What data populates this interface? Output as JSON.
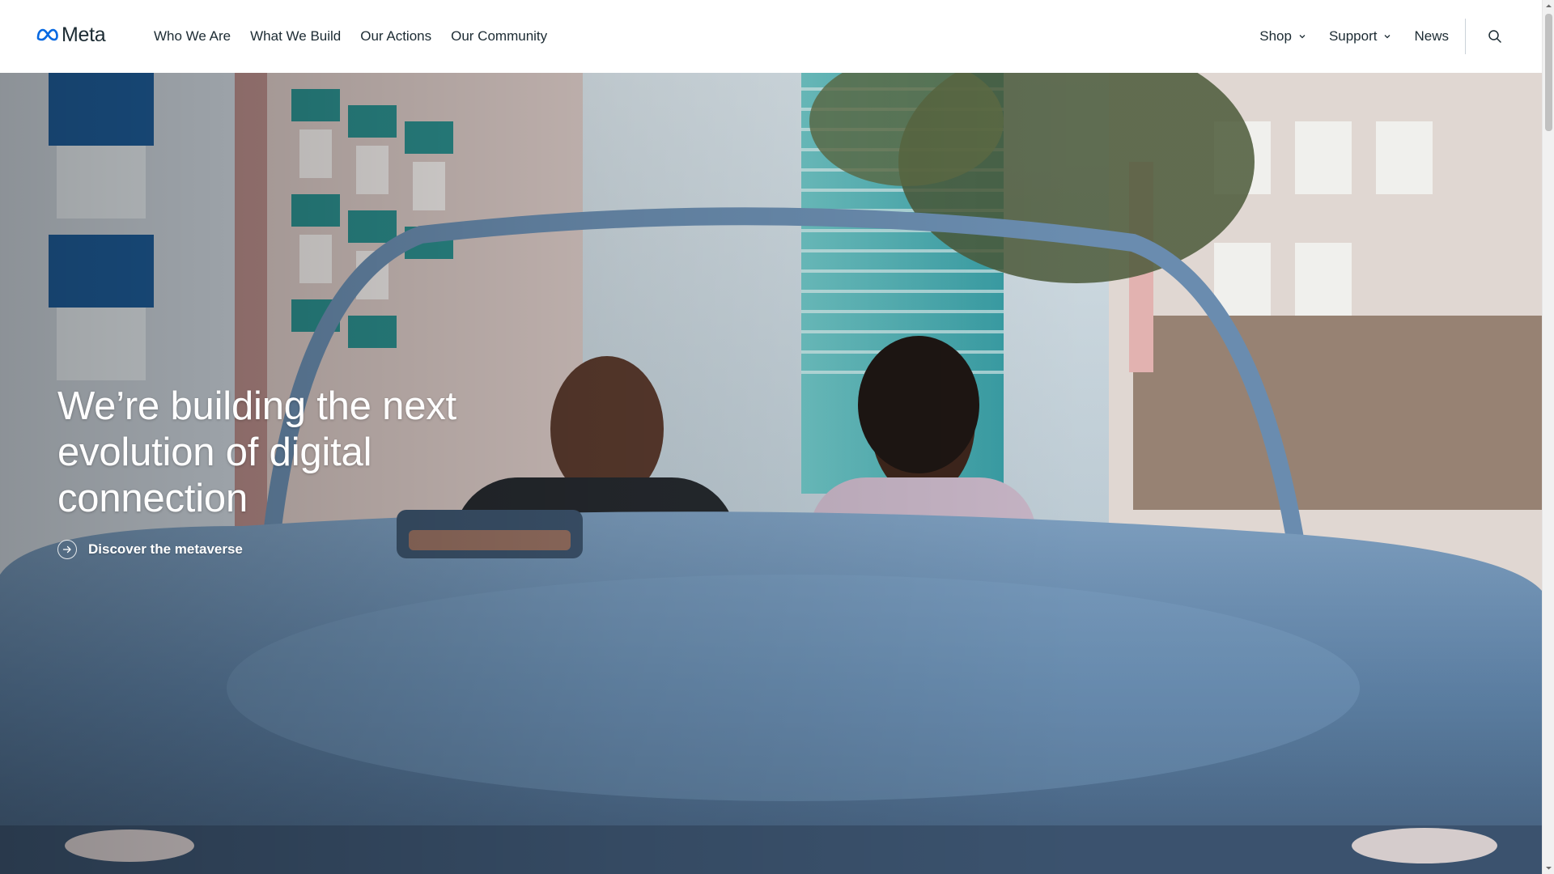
{
  "header": {
    "logo_text": "Meta",
    "nav_left": [
      {
        "label": "Who We Are"
      },
      {
        "label": "What We Build"
      },
      {
        "label": "Our Actions"
      },
      {
        "label": "Our Community"
      }
    ],
    "nav_right": [
      {
        "label": "Shop",
        "has_dropdown": true
      },
      {
        "label": "Support",
        "has_dropdown": true
      },
      {
        "label": "News",
        "has_dropdown": false
      }
    ],
    "search_icon": "search-icon"
  },
  "hero": {
    "title": "We’re building the next evolution of digital connection",
    "cta_label": "Discover the metaverse",
    "cta_icon": "arrow-right-icon"
  },
  "colors": {
    "brand_blue": "#0668e1",
    "text_dark": "#1c2b33",
    "hero_text": "#ffffff"
  }
}
